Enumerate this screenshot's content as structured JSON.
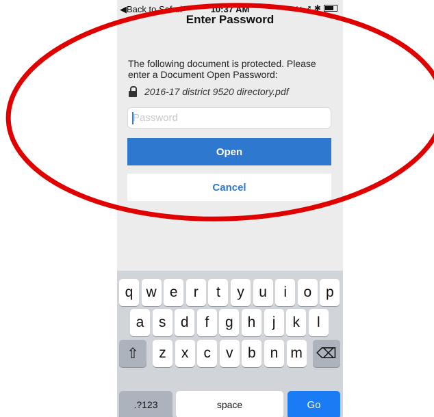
{
  "status_bar": {
    "back_label": "◀Back to Safari",
    "time": "10:37 AM",
    "icons": "↪ ➚ ✱"
  },
  "nav": {
    "title": "Enter Password"
  },
  "dialog": {
    "message": "The following document is protected. Please enter a Document Open Password:",
    "filename": "2016-17 district 9520 directory.pdf",
    "password_placeholder": "Password",
    "open_label": "Open",
    "cancel_label": "Cancel"
  },
  "keyboard": {
    "row1": [
      "q",
      "w",
      "e",
      "r",
      "t",
      "y",
      "u",
      "i",
      "o",
      "p"
    ],
    "row2": [
      "a",
      "s",
      "d",
      "f",
      "g",
      "h",
      "j",
      "k",
      "l"
    ],
    "row3": [
      "z",
      "x",
      "c",
      "v",
      "b",
      "n",
      "m"
    ],
    "shift_glyph": "⇧",
    "delete_glyph": "⌫",
    "numbers_label": ".?123",
    "space_label": "space",
    "go_label": "Go"
  },
  "colors": {
    "accent": "#2f78d0",
    "annotation_ring": "#e00000",
    "go_key": "#1a7cf5"
  }
}
